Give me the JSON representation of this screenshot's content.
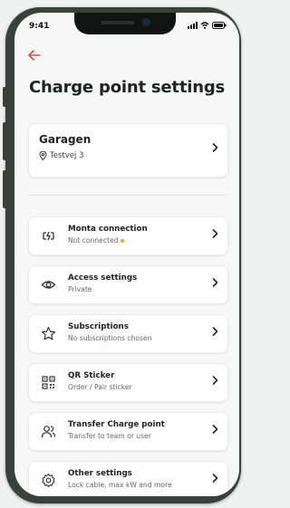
{
  "status_bar": {
    "time": "9:41"
  },
  "header": {
    "title": "Charge point settings"
  },
  "site": {
    "name": "Garagen",
    "address": "Testvej 3"
  },
  "items": [
    {
      "title": "Monta connection",
      "subtitle": "Not connected",
      "icon": "plug-icon",
      "status_color": "#f2a515"
    },
    {
      "title": "Access settings",
      "subtitle": "Private",
      "icon": "eye-icon"
    },
    {
      "title": "Subscriptions",
      "subtitle": "No subscriptions chosen",
      "icon": "star-icon"
    },
    {
      "title": "QR Sticker",
      "subtitle": "Order / Pair sticker",
      "icon": "qr-code-icon"
    },
    {
      "title": "Transfer Charge point",
      "subtitle": "Transfer to team or user",
      "icon": "users-icon"
    },
    {
      "title": "Other settings",
      "subtitle": "Lock cable, max kW and more",
      "icon": "gear-icon"
    }
  ],
  "colors": {
    "accent": "#e04a4a",
    "card": "#ffffff",
    "background": "#f7f7f7",
    "device": "#37423d"
  }
}
